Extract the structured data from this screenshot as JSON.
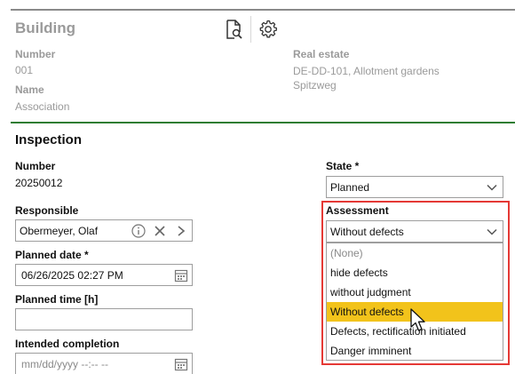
{
  "building": {
    "title": "Building",
    "number_label": "Number",
    "number_value": "001",
    "name_label": "Name",
    "name_value": "Association",
    "real_estate_label": "Real estate",
    "real_estate_line1": "DE-DD-101, Allotment gardens",
    "real_estate_line2": "Spitzweg",
    "icons": [
      "document-search-icon",
      "gear-icon"
    ]
  },
  "inspection": {
    "title": "Inspection",
    "number_label": "Number",
    "number_value": "20250012",
    "responsible_label": "Responsible",
    "responsible_value": "Obermeyer, Olaf",
    "planned_date_label": "Planned date *",
    "planned_date_value": "06/26/2025 02:27 PM",
    "planned_time_label": "Planned time [h]",
    "planned_time_value": "",
    "intended_completion_label": "Intended completion",
    "intended_completion_placeholder": "mm/dd/yyyy --:-- --",
    "state_label": "State *",
    "state_value": "Planned",
    "assessment_label": "Assessment",
    "assessment_value": "Without defects",
    "assessment_options": [
      "(None)",
      "hide defects",
      "without judgment",
      "Without defects",
      "Defects, rectification initiated",
      "Danger imminent"
    ],
    "assessment_highlighted_index": 3
  },
  "colors": {
    "accent_green": "#2e7d32",
    "highlight_yellow": "#f2c31b",
    "frame_red": "#e53935"
  }
}
